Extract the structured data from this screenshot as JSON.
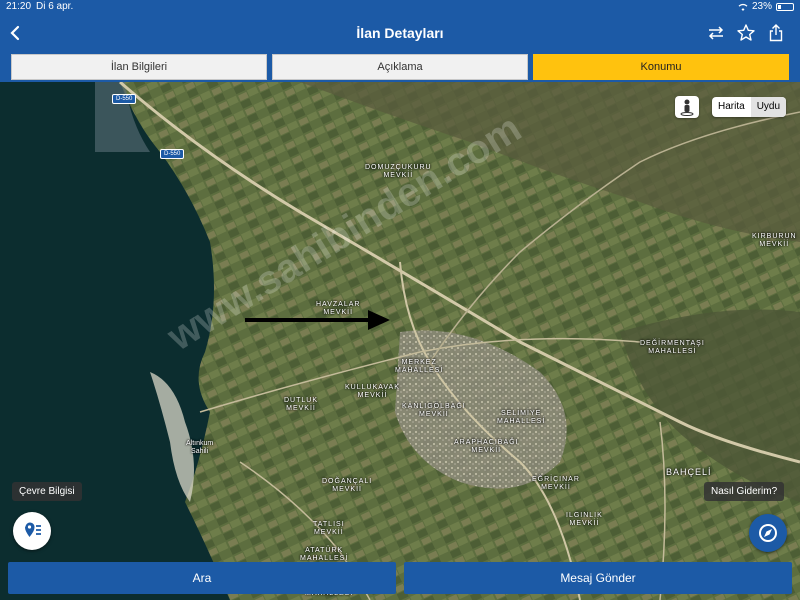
{
  "status": {
    "time": "21:20",
    "date": "Di 6 apr.",
    "battery": "23%",
    "battery_level": 0.23
  },
  "header": {
    "title": "İlan Detayları",
    "icons": [
      "back-icon",
      "compare-icon",
      "star-icon",
      "share-icon"
    ]
  },
  "tabs": [
    {
      "label": "İlan Bilgileri",
      "active": false
    },
    {
      "label": "Açıklama",
      "active": false
    },
    {
      "label": "Konumu",
      "active": true
    }
  ],
  "map": {
    "type_toggle": {
      "map_label": "Harita",
      "satellite_label": "Uydu",
      "selected": "Uydu"
    },
    "road_shields": [
      "D-550",
      "D-550"
    ],
    "labels": {
      "domuzcukuru": "DOMUZÇUKURU\nMEVKİİ",
      "havzalar": "HAVZALAR\nMEVKİİ",
      "merkez": "MERKEZ\nMAHALLESİ",
      "kullukavak": "KULLUKAVAK\nMEVKİİ",
      "dutluk": "DUTLUK\nMEVKİİ",
      "kanligolbagi": "KANLIGÖLBAĞI\nMEVKİİ",
      "selimiye": "SELİMİYE\nMAHALLESİ",
      "araphacibagi": "ARAPHACIBAĞI\nMEVKİİ",
      "degirmentasi": "DEĞİRMENTAŞI\nMAHALLESİ",
      "kirburun": "KIRBURUN\nMEVKİİ",
      "altinkum": "Altınkum\nSahili",
      "egricinar": "EĞRİÇINAR\nMEVKİİ",
      "ilgınlik": "ILGINLIK\nMEVKİİ",
      "dogancali": "DOĞANÇALI\nMEVKİİ",
      "tatlisi": "TATLISI\nMEVKİİ",
      "ataturk": "ATATÜRK\nMAHALLESİ",
      "bahceli": "BAHÇELİ",
      "mahallesi_bottom": "MAHALLESİ"
    },
    "watermark": "www.sahibinden.com",
    "environment_chip": "Çevre Bilgisi",
    "directions_chip": "Nasıl Giderim?"
  },
  "actions": {
    "call_label": "Ara",
    "message_label": "Mesaj Gönder"
  },
  "colors": {
    "brand_blue": "#1c5aa6",
    "active_tab": "#ffc20e"
  }
}
